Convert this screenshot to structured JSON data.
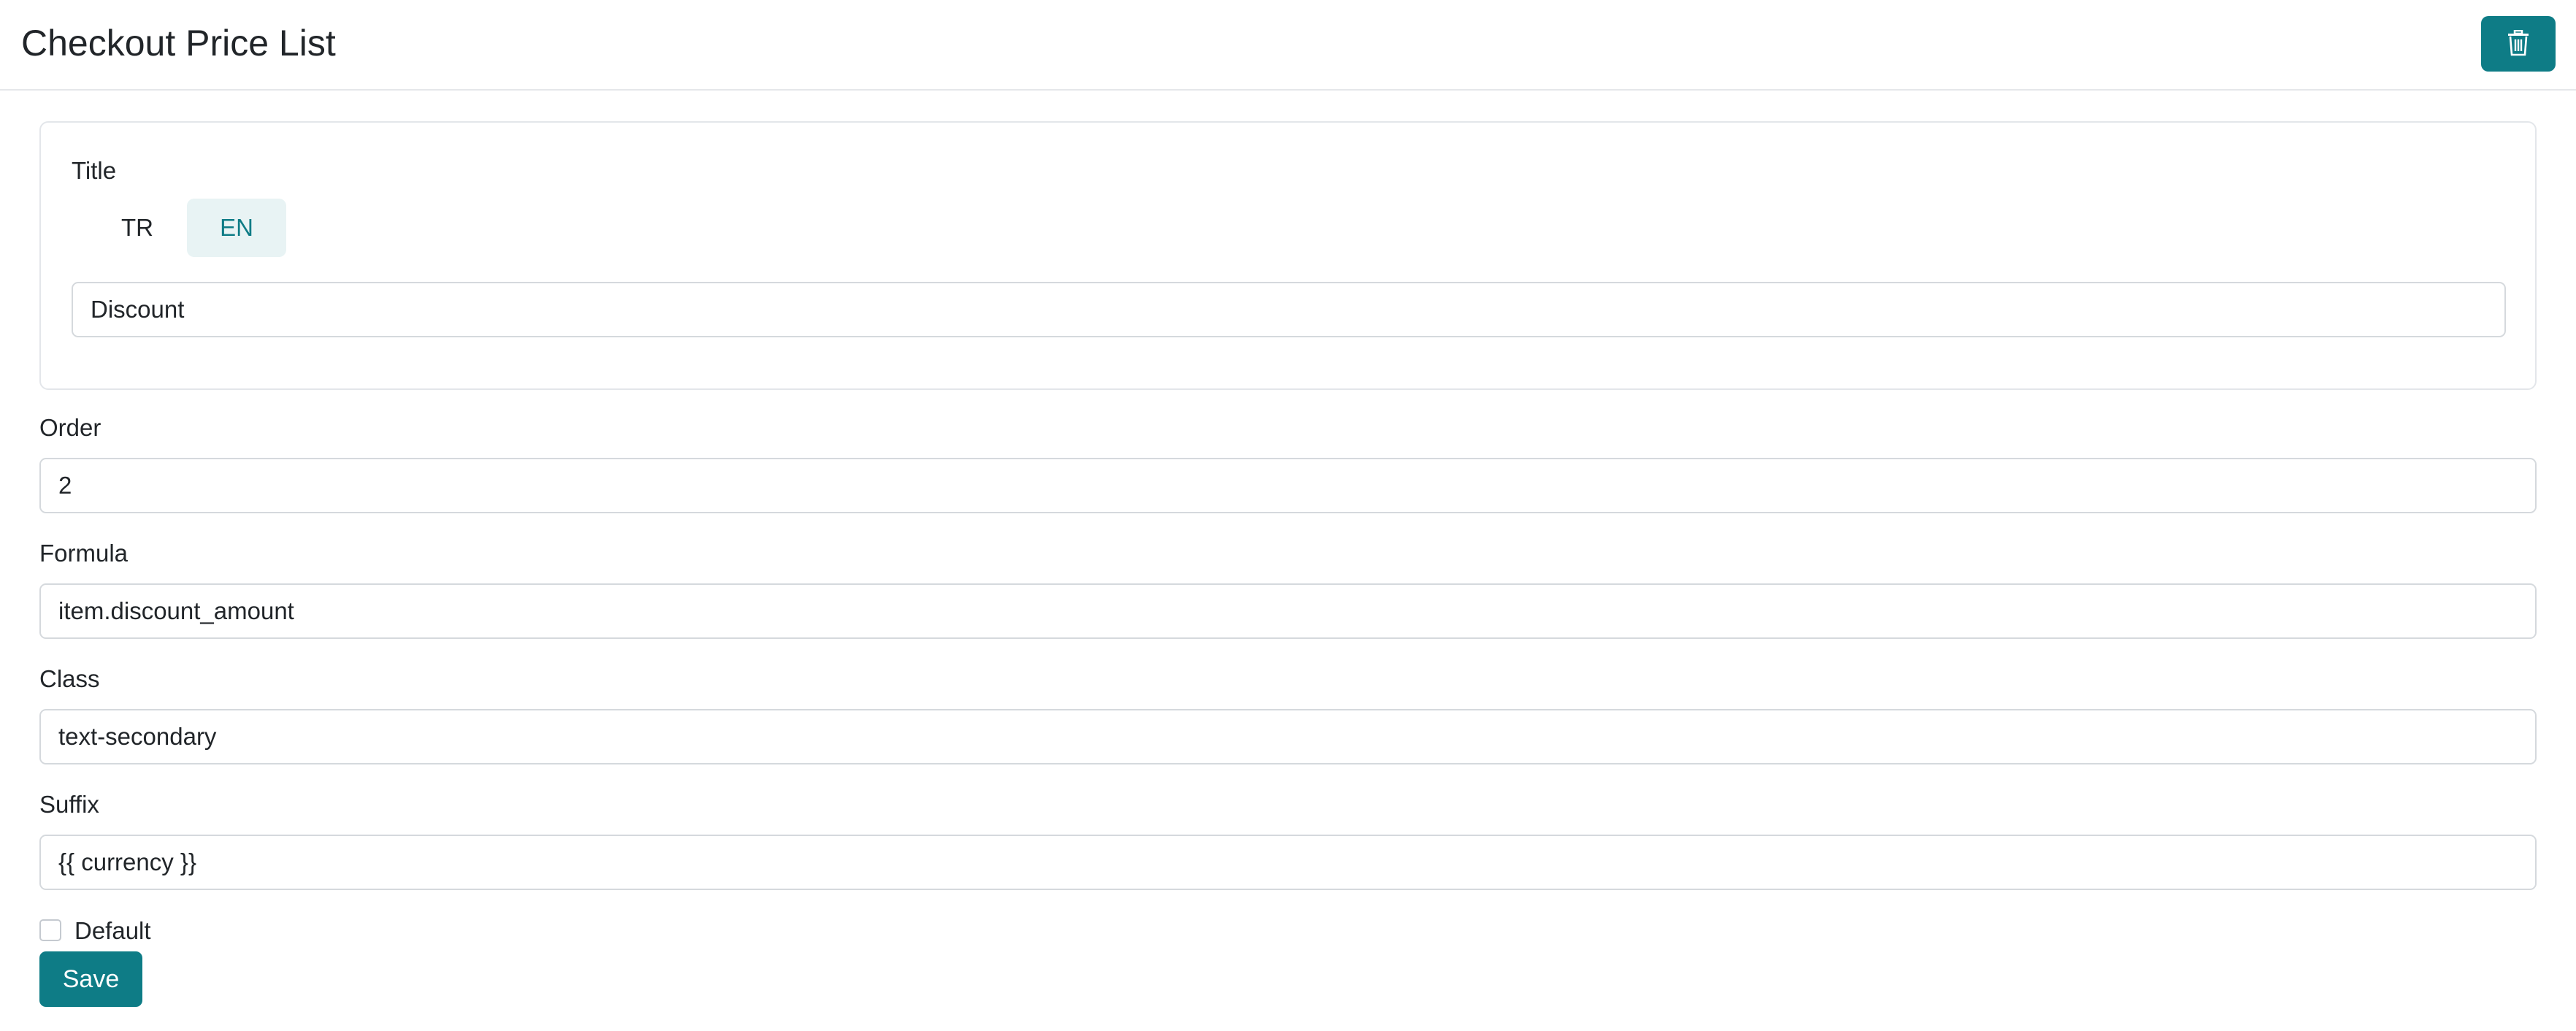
{
  "header": {
    "title": "Checkout Price List",
    "delete_icon": "trash-icon",
    "accent_color": "#0e7c86"
  },
  "title_card": {
    "label": "Title",
    "languages": [
      {
        "label": "TR",
        "active": false
      },
      {
        "label": "EN",
        "active": true
      }
    ],
    "value": "Discount"
  },
  "fields": {
    "order": {
      "label": "Order",
      "value": "2"
    },
    "formula": {
      "label": "Formula",
      "value": "item.discount_amount"
    },
    "class": {
      "label": "Class",
      "value": "text-secondary"
    },
    "suffix": {
      "label": "Suffix",
      "value": "{{ currency }}"
    }
  },
  "default_checkbox": {
    "label": "Default",
    "checked": false
  },
  "save_label": "Save"
}
